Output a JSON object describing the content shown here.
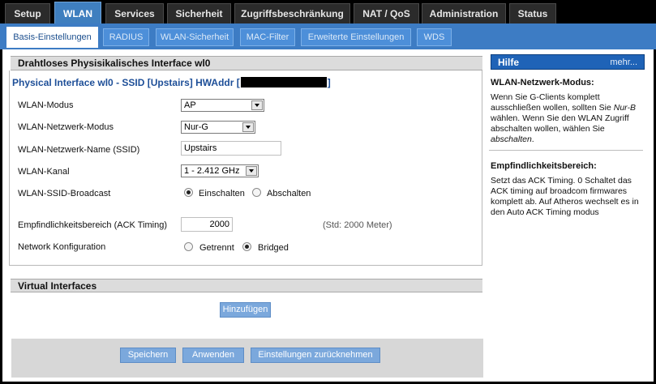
{
  "top_tabs": [
    {
      "label": "Setup"
    },
    {
      "label": "WLAN"
    },
    {
      "label": "Services"
    },
    {
      "label": "Sicherheit"
    },
    {
      "label": "Zugriffsbeschränkung"
    },
    {
      "label": "NAT / QoS"
    },
    {
      "label": "Administration"
    },
    {
      "label": "Status"
    }
  ],
  "sub_tabs": [
    {
      "label": "Basis-Einstellungen"
    },
    {
      "label": "RADIUS"
    },
    {
      "label": "WLAN-Sicherheit"
    },
    {
      "label": "MAC-Filter"
    },
    {
      "label": "Erweiterte Einstellungen"
    },
    {
      "label": "WDS"
    }
  ],
  "section_title": "Drahtloses Physisikalisches Interface wl0",
  "legend": {
    "prefix": "Physical Interface wl0 - SSID [Upstairs] HWAddr [",
    "suffix": "]"
  },
  "fields": {
    "wlan_modus": {
      "label": "WLAN-Modus",
      "value": "AP"
    },
    "netzwerk_modus": {
      "label": "WLAN-Netzwerk-Modus",
      "value": "Nur-G"
    },
    "ssid": {
      "label": "WLAN-Netzwerk-Name (SSID)",
      "value": "Upstairs"
    },
    "kanal": {
      "label": "WLAN-Kanal",
      "value": "1 - 2.412 GHz"
    },
    "ssid_broadcast": {
      "label": "WLAN-SSID-Broadcast",
      "option_on": "Einschalten",
      "option_off": "Abschalten",
      "selected": "Einschalten"
    },
    "ack_timing": {
      "label": "Empfindlichkeitsbereich (ACK Timing)",
      "value": "2000",
      "hint": "(Std: 2000 Meter)"
    },
    "network_config": {
      "label": "Network Konfiguration",
      "option_a": "Getrennt",
      "option_b": "Bridged",
      "selected": "Bridged"
    }
  },
  "virtual_interfaces": {
    "title": "Virtual Interfaces",
    "add_button": "Hinzufügen"
  },
  "footer_buttons": {
    "save": "Speichern",
    "apply": "Anwenden",
    "reset": "Einstellungen zurücknehmen"
  },
  "help": {
    "title": "Hilfe",
    "more": "mehr...",
    "sections": [
      {
        "title": "WLAN-Netzwerk-Modus:",
        "text_before": "Wenn Sie G-Clients komplett ausschließen wollen, sollten Sie ",
        "italic1": "Nur-B",
        "text_middle": " wählen. Wenn Sie den WLAN Zugriff abschalten wollen, wählen Sie ",
        "italic2": "abschalten",
        "text_after": "."
      },
      {
        "title": "Empfindlichkeitsbereich:",
        "text": "Setzt das ACK Timing. 0 Schaltet das ACK timing auf broadcom firmwares komplett ab. Auf Atheros wechselt es in den Auto ACK Timing modus"
      }
    ]
  },
  "colors": {
    "active_tab": "#3f7fbf",
    "band": "#3d7cc4",
    "legend_text": "#1e4f98",
    "help_header": "#1f63b7",
    "button": "#7ba8dc"
  }
}
